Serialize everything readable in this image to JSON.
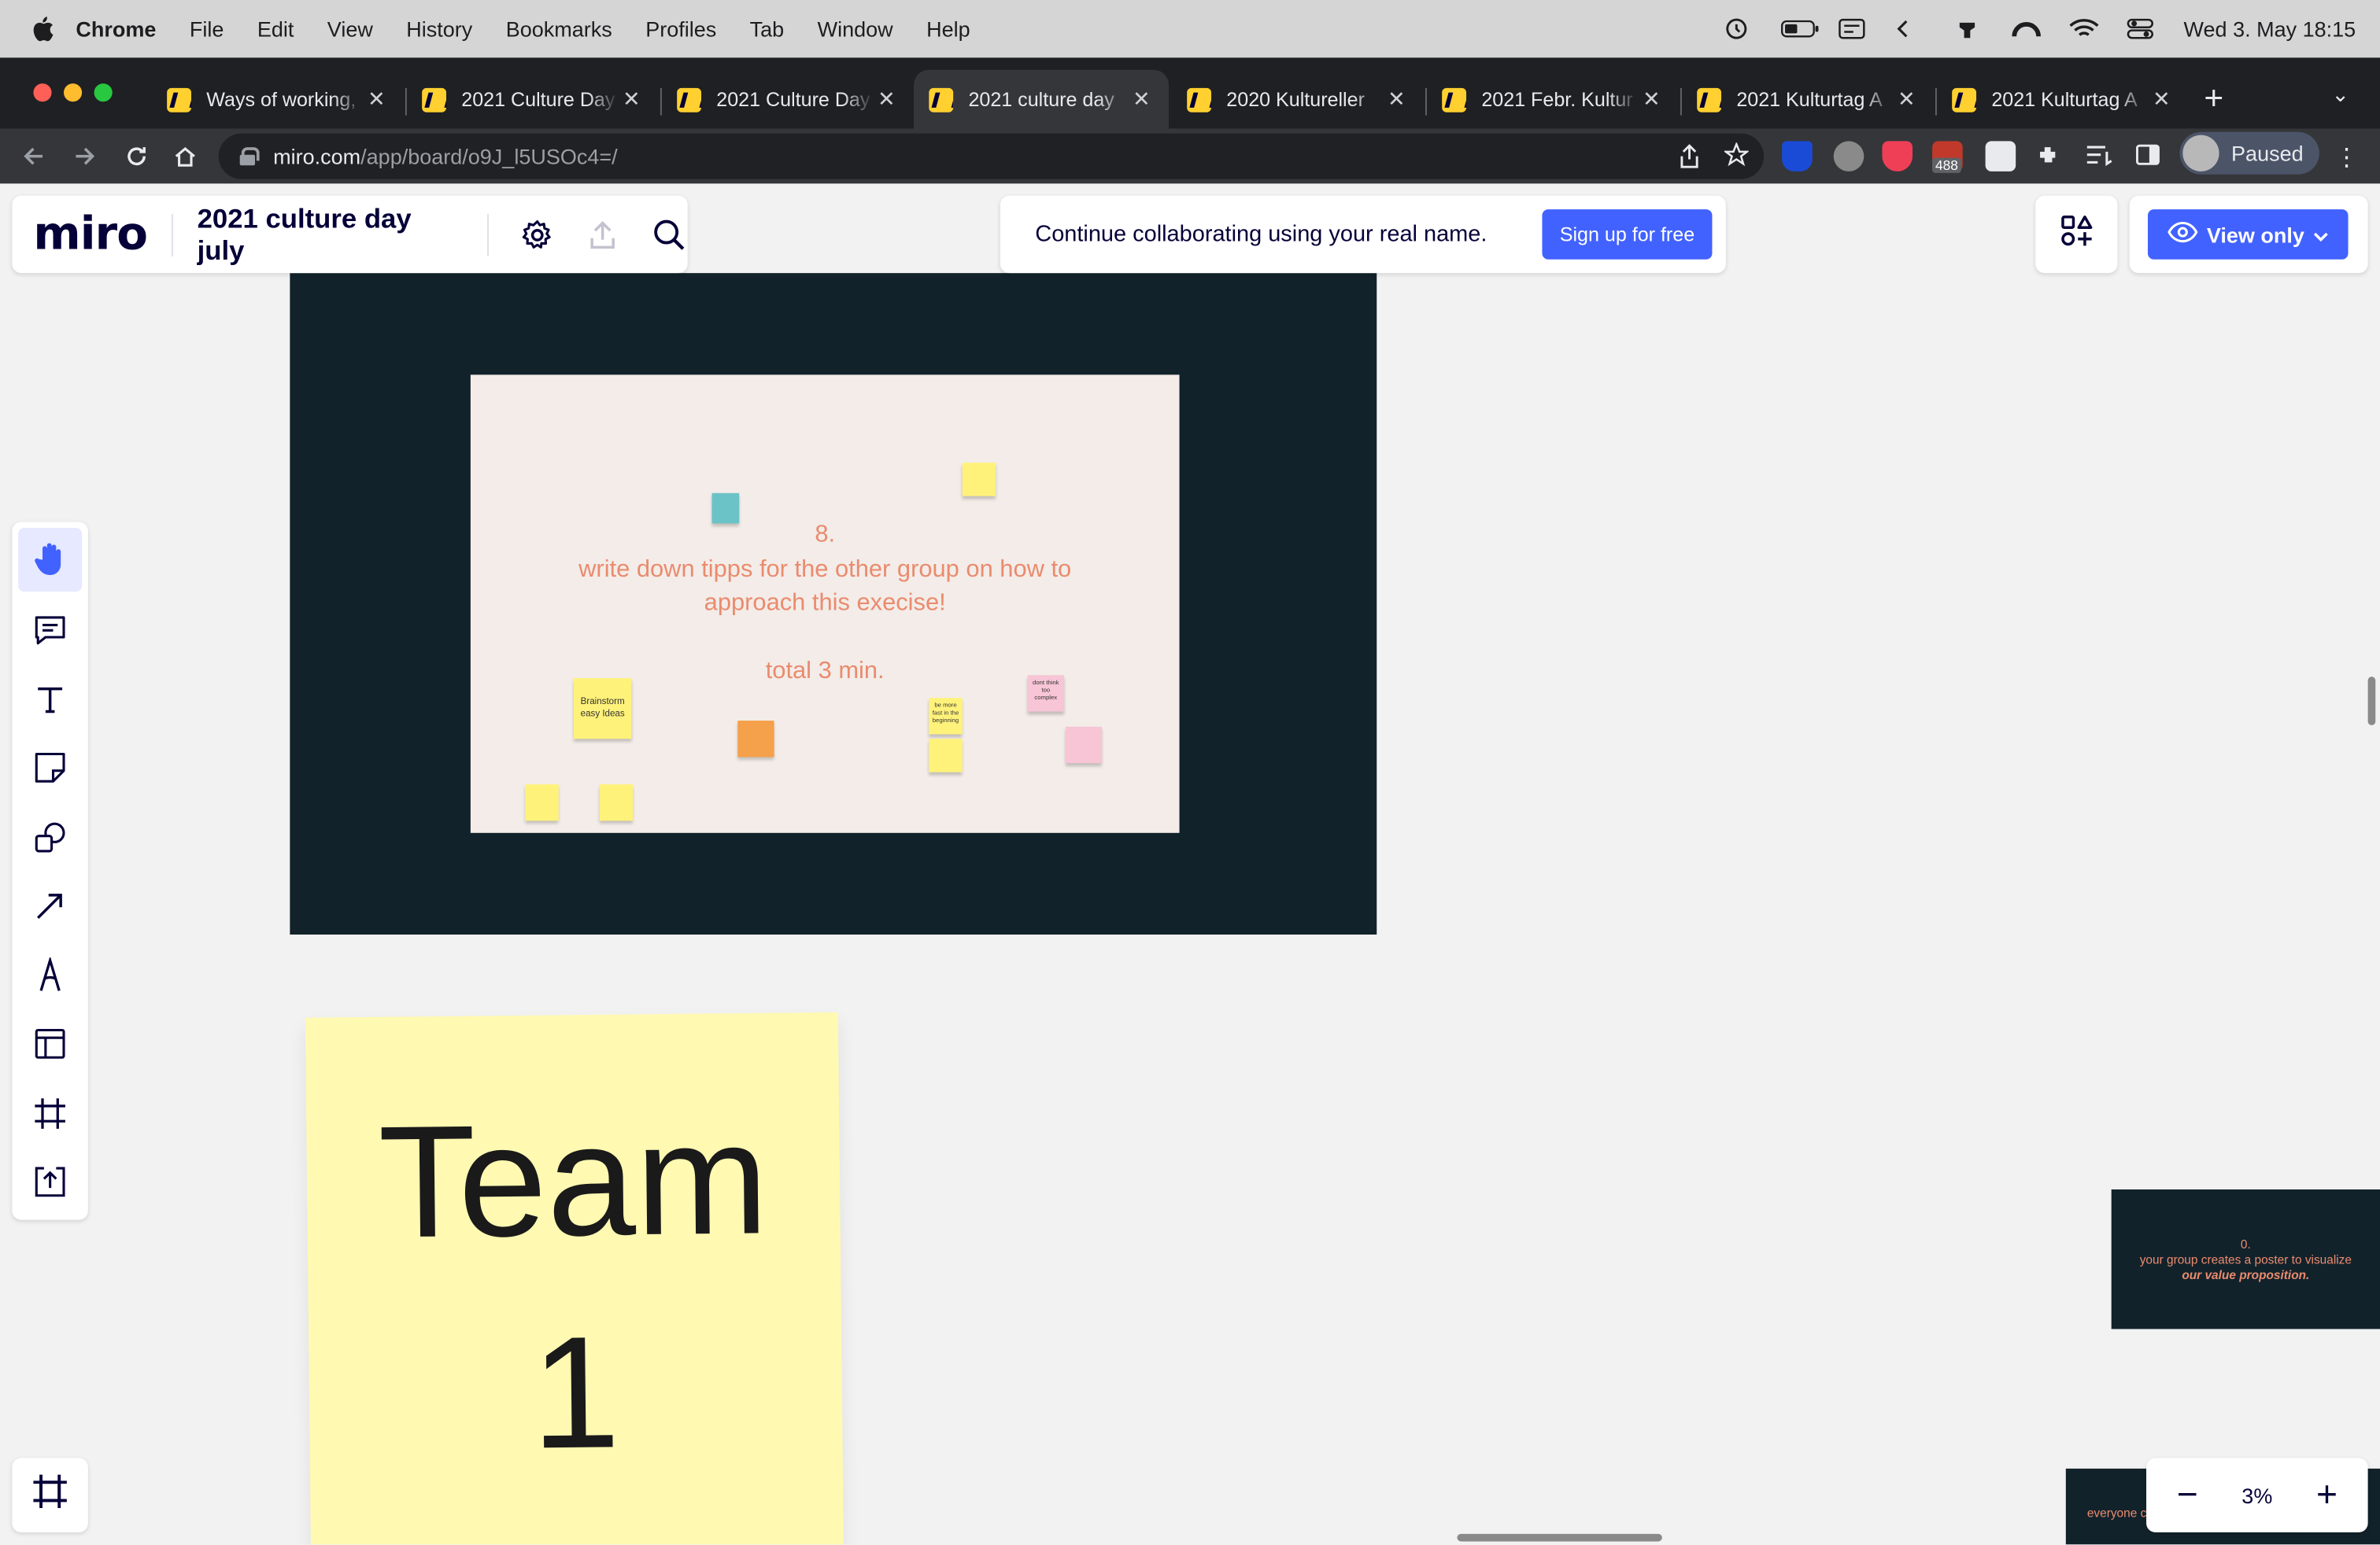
{
  "mac_menubar": {
    "app": "Chrome",
    "menus": [
      "File",
      "Edit",
      "View",
      "History",
      "Bookmarks",
      "Profiles",
      "Tab",
      "Window",
      "Help"
    ],
    "clock": "Wed 3. May  18:15"
  },
  "browser": {
    "tabs": [
      {
        "label": "Ways of working,"
      },
      {
        "label": "2021 Culture Day"
      },
      {
        "label": "2021 Culture Day"
      },
      {
        "label": "2021 culture day",
        "active": true
      },
      {
        "label": "2020 Kultureller"
      },
      {
        "label": "2021 Febr. Kultur"
      },
      {
        "label": "2021 Kulturtag A"
      },
      {
        "label": "2021 Kulturtag A"
      }
    ],
    "url_host": "miro.com",
    "url_path": "/app/board/o9J_l5USOc4=/",
    "extension_badge": "488",
    "profile_status": "Paused"
  },
  "miro": {
    "logo": "miro",
    "board_title": "2021 culture day july",
    "banner_text": "Continue collaborating using your real name.",
    "signup_label": "Sign up for free",
    "view_only_label": "View only",
    "zoom_level": "3%",
    "toolbar_icons": [
      "hand-icon",
      "comment-icon",
      "text-icon",
      "sticky-note-icon",
      "shapes-icon",
      "arrow-icon",
      "pen-icon",
      "template-icon",
      "frame-icon",
      "upload-icon"
    ]
  },
  "canvas": {
    "slide": {
      "step": "8.",
      "line1": "write down tipps for the other group on how to",
      "line2": "approach this execise!",
      "time": "total 3 min."
    },
    "notes": [
      {
        "text": "Brainstorm easy Ideas",
        "color": "#fff27a"
      },
      {
        "text": "be more fast in the beginning",
        "color": "#fff27a"
      },
      {
        "text": "dont think too complex",
        "color": "#f7c5d6"
      }
    ],
    "team_note": {
      "line1": "Team",
      "line2": "1"
    },
    "side_frame": {
      "step": "0.",
      "text": "your group creates a poster to visualize",
      "emphasis": "our value proposition."
    },
    "bottom_frame_text": "everyone c"
  }
}
